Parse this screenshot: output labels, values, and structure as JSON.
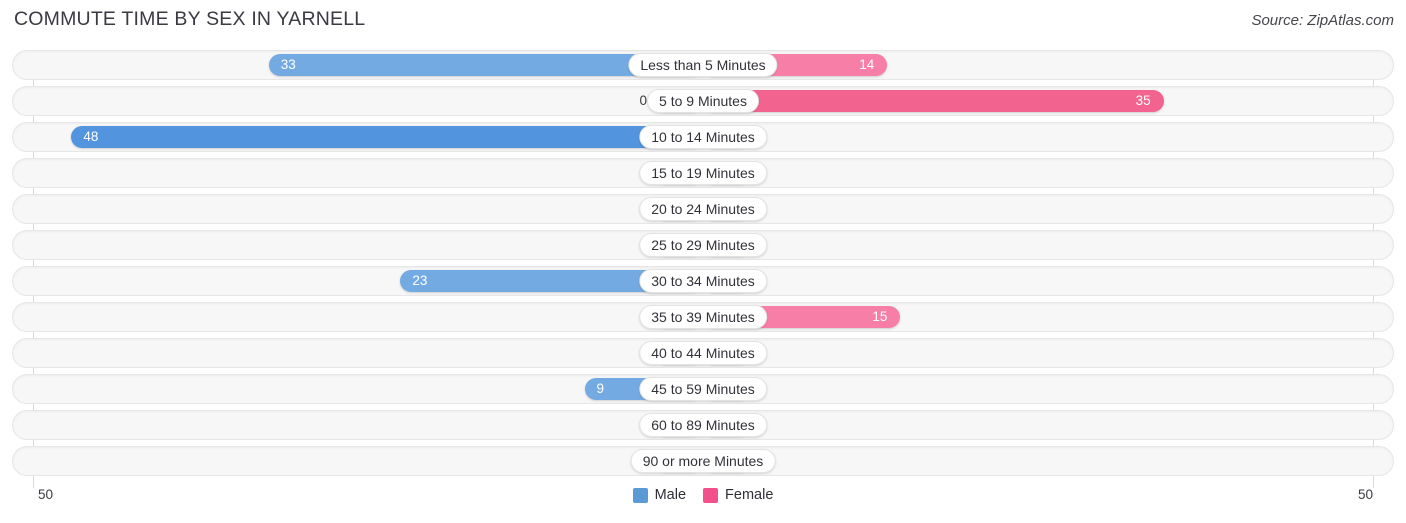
{
  "header": {
    "title": "COMMUTE TIME BY SEX IN YARNELL",
    "source": "Source: ZipAtlas.com"
  },
  "axis": {
    "left_tick": "50",
    "right_tick": "50"
  },
  "legend": {
    "male_label": "Male",
    "female_label": "Female",
    "male_color": "#5b9bd5",
    "female_color": "#f2508a"
  },
  "colors": {
    "male_strong": "#5294dd",
    "male_mid": "#74aae2",
    "male_light": "#a8c8ec",
    "female_strong": "#f2648f",
    "female_mid": "#f77fa7",
    "female_light": "#f995b5"
  },
  "chart_data": {
    "type": "bar",
    "title": "COMMUTE TIME BY SEX IN YARNELL",
    "subtitle": "Source: ZipAtlas.com",
    "orientation": "horizontal-diverging",
    "xlabel": "",
    "ylabel": "",
    "xlim": [
      -50,
      50
    ],
    "axis_max": 50,
    "grid": false,
    "legend_position": "bottom-center",
    "categories": [
      "Less than 5 Minutes",
      "5 to 9 Minutes",
      "10 to 14 Minutes",
      "15 to 19 Minutes",
      "20 to 24 Minutes",
      "25 to 29 Minutes",
      "30 to 34 Minutes",
      "35 to 39 Minutes",
      "40 to 44 Minutes",
      "45 to 59 Minutes",
      "60 to 89 Minutes",
      "90 or more Minutes"
    ],
    "series": [
      {
        "name": "Male",
        "side": "left",
        "values": [
          33,
          0,
          48,
          0,
          0,
          0,
          23,
          0,
          0,
          9,
          0,
          0
        ],
        "labels": [
          "33",
          "0",
          "48",
          "0",
          "0",
          "0",
          "23",
          "0",
          "0",
          "9",
          "0",
          "0"
        ]
      },
      {
        "name": "Female",
        "side": "right",
        "values": [
          14,
          35,
          0,
          0,
          0,
          0,
          0,
          15,
          0,
          0,
          0,
          0
        ],
        "labels": [
          "14",
          "35",
          "0",
          "0",
          "0",
          "0",
          "0",
          "15",
          "0",
          "0",
          "0",
          "0"
        ]
      }
    ]
  }
}
